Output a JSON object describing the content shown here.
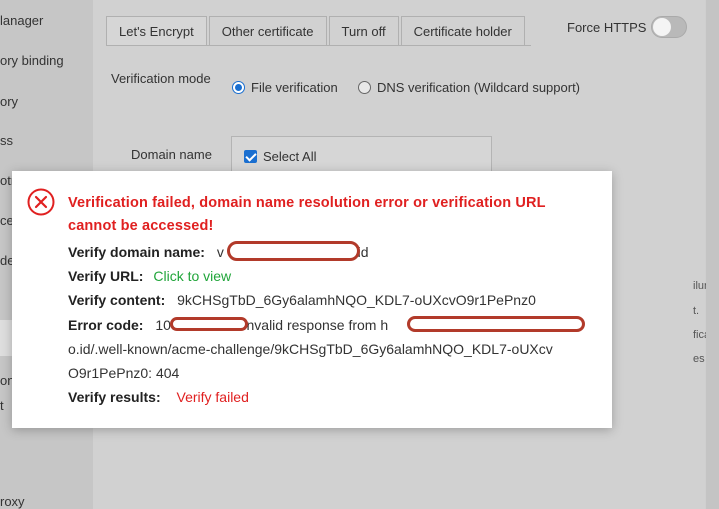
{
  "sidebar": {
    "items": [
      "lanager",
      "ory binding",
      "ory",
      "ss",
      "otr",
      "ce",
      "de",
      "on",
      "t",
      "roxy"
    ]
  },
  "tabs": [
    "Let's Encrypt",
    "Other certificate",
    "Turn off",
    "Certificate holder"
  ],
  "force_https": {
    "label": "Force HTTPS",
    "enabled": false
  },
  "verification_mode": {
    "label": "Verification mode",
    "options": [
      "File verification",
      "DNS verification (Wildcard support)"
    ],
    "selected": "File verification"
  },
  "domain_name": {
    "label": "Domain name",
    "select_all": "Select All",
    "checked": true
  },
  "background_notes": [
    "ilure.",
    "t.",
    "fication.",
    "es not have"
  ],
  "modal": {
    "icon": "error-circle-x-icon",
    "title": "Verification failed, domain name resolution error or verification URL cannot be accessed!",
    "verify_domain_label": "Verify domain name:",
    "verify_domain_value_prefix": "v",
    "verify_domain_value_suffix": ".id",
    "verify_url_label": "Verify URL:",
    "verify_url_link": "Click to view",
    "verify_content_label": "Verify content:",
    "verify_content_value": "9kCHSgTbD_6Gy6alamhNQO_KDL7-oUXcvO9r1PePnz0",
    "error_code_label": "Error code:",
    "error_code_prefix": "103",
    "error_code_mid": "Invalid response from h",
    "error_line2": "o.id/.well-known/acme-challenge/9kCHSgTbD_6Gy6alamhNQO_KDL7-oUXcv",
    "error_line3": "O9r1PePnz0: 404",
    "verify_results_label": "Verify results:",
    "verify_results_value": "Verify failed"
  },
  "colors": {
    "error_red": "#e02020",
    "link_green": "#20a53a",
    "primary_blue": "#1a6fd0",
    "redaction": "#b23a2a"
  }
}
